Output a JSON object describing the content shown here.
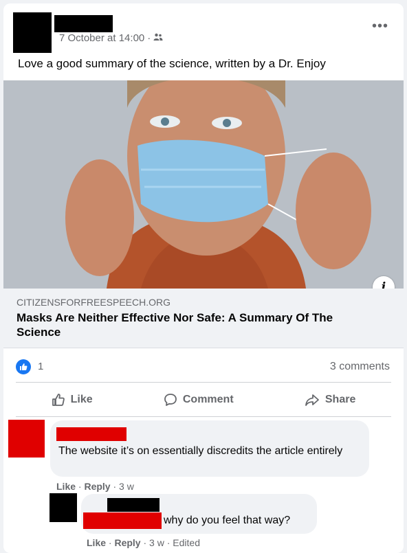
{
  "post": {
    "timestamp": "7 October at 14:00",
    "separator": "·",
    "audience_icon": "friends-icon",
    "text": "Love a good summary of the science, written by a Dr. Enjoy",
    "more_icon": "•••"
  },
  "link": {
    "domain": "CITIZENSFORFREESPEECH.ORG",
    "title": "Masks Are Neither Effective Nor Safe: A Summary Of The Science",
    "info_icon": "i"
  },
  "stats": {
    "likes": "1",
    "comments": "3 comments"
  },
  "actions": {
    "like": "Like",
    "comment": "Comment",
    "share": "Share"
  },
  "comments": [
    {
      "text": "The website it’s on essentially discredits the article entirely",
      "like": "Like",
      "reply": "Reply",
      "time": "3 w",
      "sep": "·"
    },
    {
      "text": "why do you feel that way?",
      "like": "Like",
      "reply": "Reply",
      "time": "3 w",
      "edited": "Edited",
      "sep": "·"
    }
  ],
  "colors": {
    "accent": "#1877f2",
    "redaction_red": "#e00000",
    "secondary_text": "#65676b"
  }
}
